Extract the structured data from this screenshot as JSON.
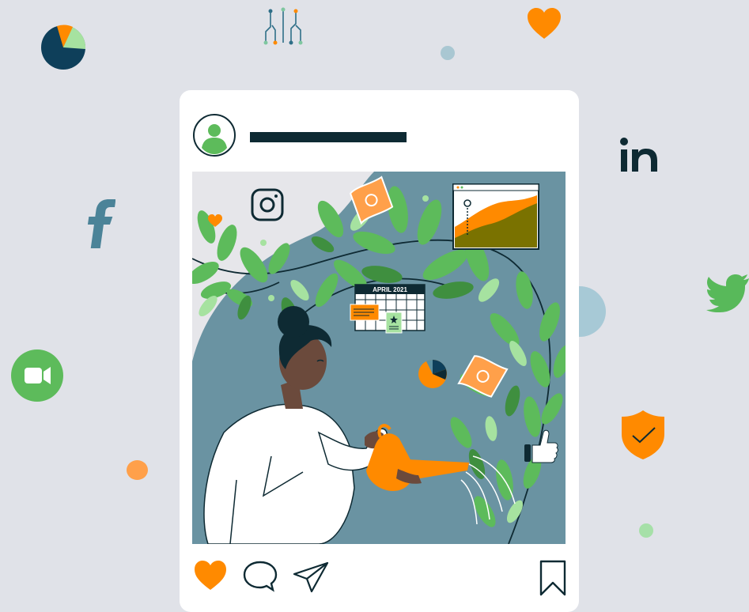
{
  "post": {
    "calendar_title": "APRIL 2021"
  },
  "icons": {
    "social": [
      "instagram-icon",
      "facebook-icon",
      "linkedin-icon",
      "twitter-icon",
      "zoom-icon"
    ],
    "actions": [
      "heart-icon",
      "comment-icon",
      "share-icon",
      "bookmark-icon"
    ]
  },
  "colors": {
    "background": "#e0e2e8",
    "card": "#ffffff",
    "navy": "#0e2a33",
    "orange": "#ff8a00",
    "green": "#5dbb5b",
    "teal": "#5b8fa0",
    "social_blue": "#4b8398"
  }
}
